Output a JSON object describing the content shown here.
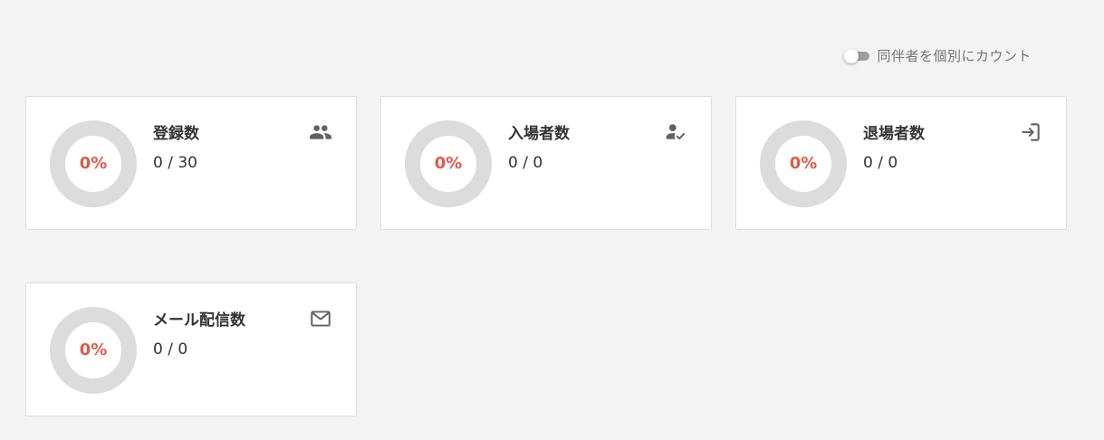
{
  "toggle": {
    "label": "同伴者を個別にカウント",
    "on": false
  },
  "colors": {
    "percent_text": "#e05a47",
    "donut_ring": "#dcdcdc",
    "card_bg": "#ffffff",
    "page_bg": "#f3f3f3",
    "icon": "#616161"
  },
  "cards": [
    {
      "title": "登録数",
      "percent": "0%",
      "count": "0 / 30",
      "icon": "people-icon"
    },
    {
      "title": "入場者数",
      "percent": "0%",
      "count": "0 / 0",
      "icon": "person-check-icon"
    },
    {
      "title": "退場者数",
      "percent": "0%",
      "count": "0 / 0",
      "icon": "exit-icon"
    },
    {
      "title": "メール配信数",
      "percent": "0%",
      "count": "0 / 0",
      "icon": "mail-icon"
    }
  ]
}
